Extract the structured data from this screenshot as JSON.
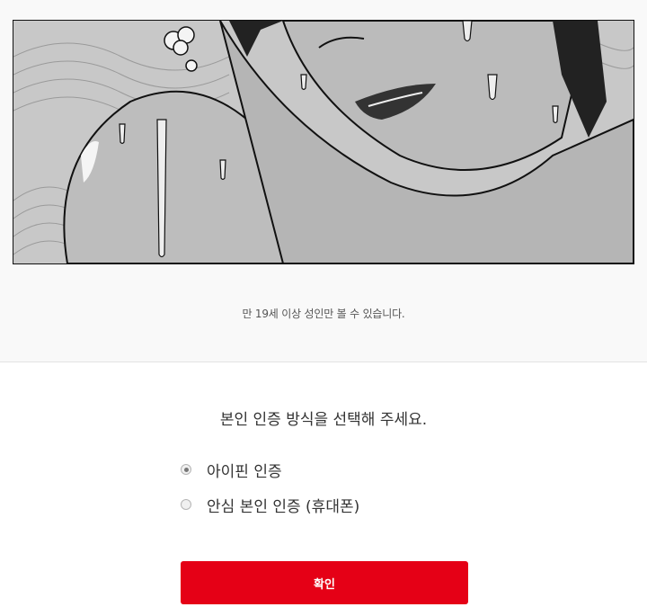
{
  "banner": {
    "image_alt": "manga-panel-illustration"
  },
  "notice_text": "만 19세 이상 성인만 볼 수 있습니다.",
  "prompt_text": "본인 인증 방식을 선택해 주세요.",
  "options": [
    {
      "label": "아이핀 인증",
      "checked": true
    },
    {
      "label": "안심 본인 인증 (휴대폰)",
      "checked": false
    }
  ],
  "confirm_label": "확인",
  "colors": {
    "accent": "#e50016",
    "top_background": "#f9f9f9"
  }
}
